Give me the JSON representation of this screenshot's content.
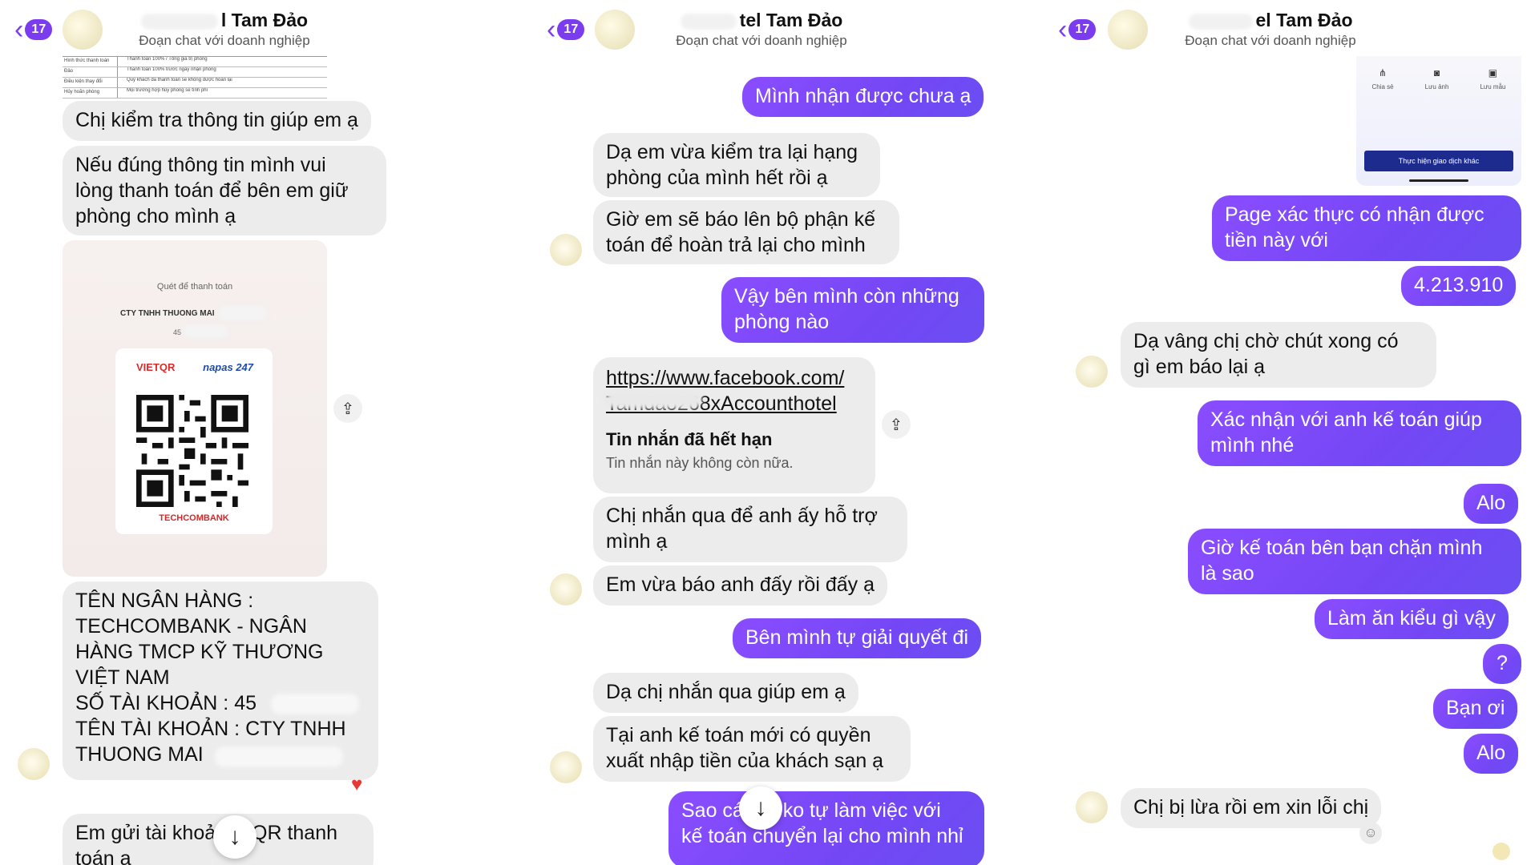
{
  "header": {
    "back_count": "17",
    "title_fragment_1": "l Tam Đảo",
    "title_fragment_2": "tel Tam Đảo",
    "title_fragment_3": "el Tam Đảo",
    "subtitle": "Đoạn chat với doanh nghiệp"
  },
  "panel1": {
    "msg_check_info": "Chị kiểm tra thông tin giúp em ạ",
    "msg_payment": [
      "Nếu đúng thông tin mình vui",
      "lòng thanh toán để bên em giữ",
      "phòng cho mình ạ"
    ],
    "qr": {
      "title": "Quét để thanh toán",
      "company": "CTY TNHH THUONG MAI",
      "account_prefix": "45",
      "brand_left": "VIETQR",
      "brand_right": "napas 247",
      "bank": "TECHCOMBANK"
    },
    "bank_info": [
      "TÊN NGÂN HÀNG :",
      "TECHCOMBANK - NGÂN",
      "HÀNG TMCP KỸ THƯƠNG",
      "VIỆT NAM",
      "SỐ TÀI KHOẢN :  45",
      "TÊN TÀI KHOẢN :  CTY TNHH",
      "THUONG MAI"
    ],
    "msg_send_qr_a": "Em gửi tài khoả",
    "msg_send_qr_b": "n QR thanh",
    "msg_send_qr_c": "toán ạ"
  },
  "panel2": {
    "msg_received": "Mình nhận được chưa ạ",
    "msg_rooms_full": [
      "Dạ em vừa kiểm tra lại hạng",
      "phòng của mình hết rồi ạ"
    ],
    "msg_refund": [
      "Giờ em sẽ báo lên bộ phận kế",
      "toán để hoàn trả lại cho mình"
    ],
    "msg_which_rooms": [
      "Vậy bên mình còn những",
      "phòng nào"
    ],
    "link_url_1": "https://www.facebook.com/",
    "link_url_2": "Tamdao268xAccounthotel",
    "expired_title": "Tin nhắn đã hết hạn",
    "expired_sub": "Tin nhắn này không còn nữa.",
    "msg_contact": [
      "Chị nhắn qua để anh ấy hỗ trợ",
      "mình ạ"
    ],
    "msg_reported": "Em vừa báo anh đấy rồi đấy ạ",
    "msg_resolve": "Bên mình tự giải quyết đi",
    "msg_please_text": "Dạ chị nhắn qua giúp em ạ",
    "msg_accountant": [
      "Tại anh kế toán mới có quyền",
      "xuất nhập tiền của khách sạn ạ"
    ],
    "msg_why_a": "Sao cá",
    "msg_why_b": "n ko tự làm việc với",
    "msg_why_c": "kế toán chuyển lại cho mình nhỉ"
  },
  "panel3": {
    "bank_screen": {
      "action_1": "Chia sẻ",
      "action_2": "Lưu ảnh",
      "action_3": "Lưu mẫu",
      "button": "Thực hiện giao dịch khác"
    },
    "msg_verify": [
      "Page xác thực có nhận được",
      "tiền này với"
    ],
    "msg_amount": "4.213.910",
    "msg_wait": [
      "Dạ vâng chị chờ chút xong có",
      "gì em báo lại ạ"
    ],
    "msg_confirm": [
      "Xác nhận với anh kế toán giúp",
      "mình nhé"
    ],
    "msg_alo_1": "Alo",
    "msg_blocked": [
      "Giờ kế toán bên bạn chặn mình",
      "là sao"
    ],
    "msg_business": "Làm ăn kiểu gì vậy",
    "msg_question": "?",
    "msg_friend": "Bạn ơi",
    "msg_alo_2": "Alo",
    "msg_scammed": "Chị bị lừa rồi em xin lỗi chị"
  },
  "icons": {
    "back": "chevron-left-icon",
    "share": "share-icon",
    "scroll_down": "arrow-down-icon",
    "heart": "heart-icon",
    "add_reaction": "add-reaction-icon"
  },
  "colors": {
    "accent": "#7b3cf0",
    "sent_bubble": "#7447f5",
    "received_bubble": "#ececec",
    "heart": "#e53935"
  }
}
